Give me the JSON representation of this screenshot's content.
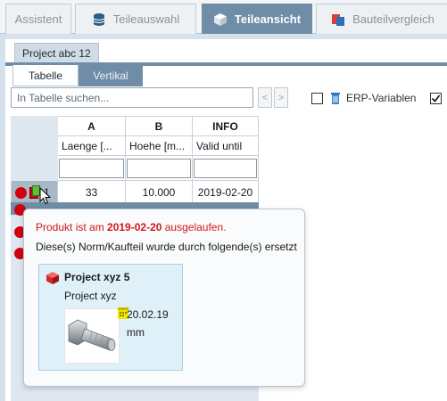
{
  "tabs": [
    {
      "label": "Assistent",
      "icon": "none"
    },
    {
      "label": "Teileauswahl",
      "icon": "database-icon"
    },
    {
      "label": "Teileansicht",
      "icon": "cube-icon"
    },
    {
      "label": "Bauteilvergleich",
      "icon": "compare-icon"
    }
  ],
  "project": {
    "tab_label": "Project abc 12",
    "subtabs": [
      "Tabelle",
      "Vertikal"
    ]
  },
  "search": {
    "placeholder": "In Tabelle suchen...",
    "prev": "<",
    "next": ">",
    "erp_label": "ERP-Variablen"
  },
  "table": {
    "columns": [
      {
        "letter": "A",
        "name": "Laenge [..."
      },
      {
        "letter": "B",
        "name": "Hoehe [m..."
      },
      {
        "letter": "INFO",
        "name": "Valid until"
      }
    ],
    "rows": [
      {
        "index": "1",
        "values": [
          "33",
          "10.000",
          "2019-02-20"
        ]
      }
    ]
  },
  "tooltip": {
    "line1_prefix": "Produkt ist am ",
    "line1_date": "2019-02-20",
    "line1_suffix": " ausgelaufen.",
    "line2": "Diese(s) Norm/Kaufteil wurde durch folgende(s) ersetzt",
    "replacement": {
      "title": "Project xyz 5",
      "subtitle": "Project xyz",
      "date": "20.02.19",
      "unit": "mm"
    }
  },
  "colors": {
    "accent": "#6f8da7",
    "status_red": "#d0000f",
    "warning_text": "#d01818"
  }
}
